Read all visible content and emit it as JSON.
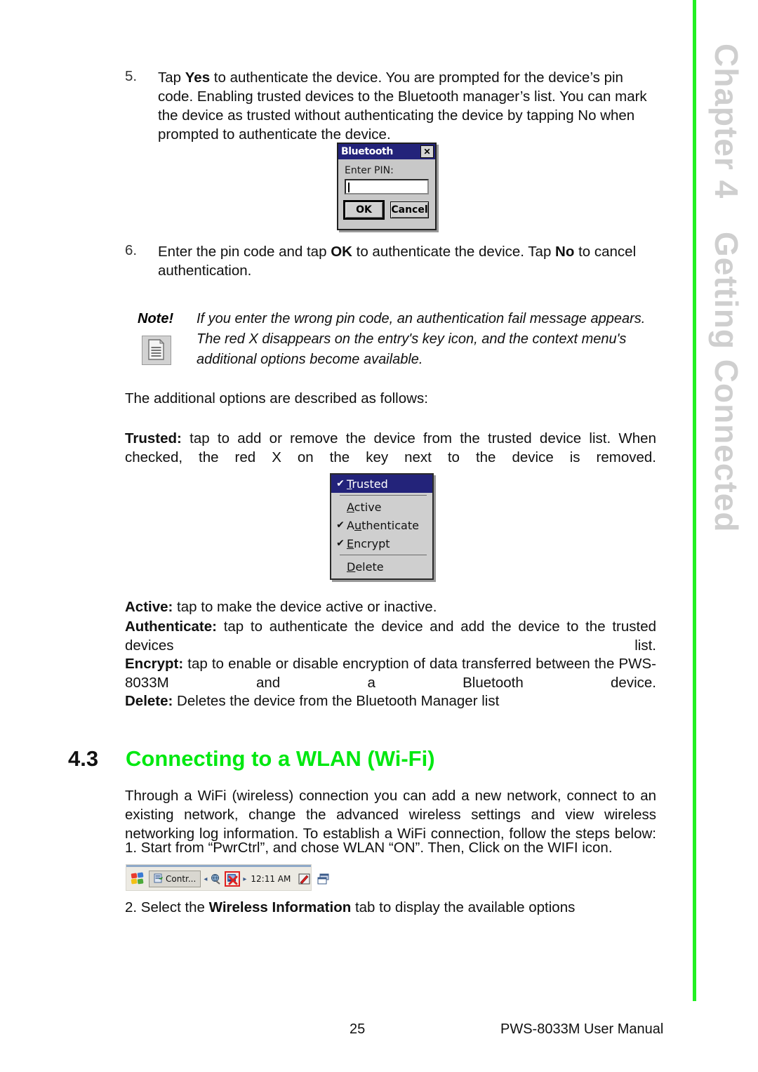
{
  "chapter_margin": {
    "number": "Chapter 4",
    "title": "Getting Connected",
    "rule_color": "#22f022"
  },
  "steps": [
    {
      "number": "5.",
      "text_before": "Tap ",
      "bold1": "Yes",
      "text_mid": " to authenticate the device. You are prompted for the device’s pin code. Enabling trusted devices to the Bluetooth manager’s list. You can mark the device as trusted without authenticating the device by tapping No when prompted to authenticate the device."
    },
    {
      "number": "6.",
      "text_before": "Enter the pin code and tap ",
      "bold1": "OK",
      "text_mid": " to authenticate the device. Tap ",
      "bold2": "No",
      "text_after": " to cancel authentication."
    }
  ],
  "bluetooth_dialog": {
    "title": "Bluetooth",
    "close_label": "✕",
    "pin_label": "Enter PIN:",
    "pin_value": "",
    "ok_label": "OK",
    "cancel_label": "Cancel",
    "titlebar_color": "#23237a"
  },
  "note": {
    "label": "Note!",
    "text": "If you enter the wrong pin code, an authentication fail message appears. The red X disappears on the entry's key icon, and the context menu's additional options become available.",
    "icon": "document-icon"
  },
  "body": {
    "intro": "The additional options are described as follows:",
    "trusted_bold": "Trusted:",
    "trusted_text": " tap to add or remove the device from the trusted device list. When checked, the red X on the key next to the device is removed."
  },
  "context_menu": {
    "items": [
      {
        "label_pre": "",
        "accel": "T",
        "label_post": "rusted",
        "checked": true,
        "highlighted": true
      },
      {
        "separator": true
      },
      {
        "label_pre": "",
        "accel": "A",
        "label_post": "ctive",
        "checked": false,
        "highlighted": false
      },
      {
        "label_pre": "A",
        "accel": "u",
        "label_post": "thenticate",
        "checked": true,
        "highlighted": false
      },
      {
        "label_pre": "",
        "accel": "E",
        "label_post": "ncrypt",
        "checked": true,
        "highlighted": false
      },
      {
        "separator": true
      },
      {
        "label_pre": "",
        "accel": "D",
        "label_post": "elete",
        "checked": false,
        "highlighted": false
      }
    ],
    "check_glyph": "✔",
    "highlight_color": "#23237a"
  },
  "options": [
    {
      "bold": "Active:",
      "text": " tap to make the device active or inactive."
    },
    {
      "bold": "Authenticate:",
      "text": " tap to authenticate the device and add the device to the trusted devices list."
    },
    {
      "bold": "Encrypt:",
      "text": " tap to enable or disable encryption of data transferred between the PWS-8033M and a Bluetooth device."
    },
    {
      "bold": "Delete:",
      "text": " Deletes the device from the Bluetooth Manager list"
    }
  ],
  "section": {
    "number": "4.3",
    "title": "Connecting to a WLAN (Wi-Fi)",
    "title_color": "#00e810",
    "paragraph": "Through a WiFi (wireless) connection you can add a new network, connect to an existing network, change the advanced wireless settings and view wireless networking log information. To establish a WiFi connection, follow the steps below:",
    "step1": "1. Start from “PwrCtrl”, and chose WLAN “ON”. Then, Click on the WIFI icon.",
    "step2_pre": "2. Select the ",
    "step2_bold": "Wireless Information",
    "step2_post": " tab to display the available options"
  },
  "taskbar": {
    "start_icon": "windows-flag-icon",
    "app_button_label": "Contr...",
    "app_button_icon": "control-panel-icon",
    "network_icon": "network-globe-icon",
    "wifi_icon": "wifi-disconnected-icon",
    "wifi_highlight_color": "#e02020",
    "clock": "12:11 AM",
    "input_panel_icon": "pen-input-icon",
    "window-switch_icon": "window-switch-icon",
    "arrow_left": "◂",
    "arrow_right": "▸"
  },
  "footer": {
    "page_number": "25",
    "manual_name": "PWS-8033M User Manual"
  }
}
